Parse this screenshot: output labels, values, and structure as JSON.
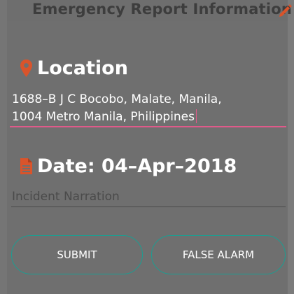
{
  "header": {
    "title": "Emergency Report Information",
    "edit_icon": "pencil-icon"
  },
  "location": {
    "icon": "map-pin-icon",
    "label": "Location",
    "address_line1": "1688–B J C Bocobo, Malate, Manila,",
    "address_line2": "1004 Metro Manila, Philippines"
  },
  "date": {
    "icon": "document-icon",
    "label": "Date: 04–Apr–2018"
  },
  "narration": {
    "placeholder": "Incident Narration",
    "value": ""
  },
  "buttons": {
    "submit_label": "SUBMIT",
    "false_alarm_label": "FALSE ALARM"
  },
  "colors": {
    "accent_orange": "#d9542b",
    "underline_pink": "#e05a8a",
    "button_border": "#1a9e92",
    "background": "#6f6f6f"
  }
}
